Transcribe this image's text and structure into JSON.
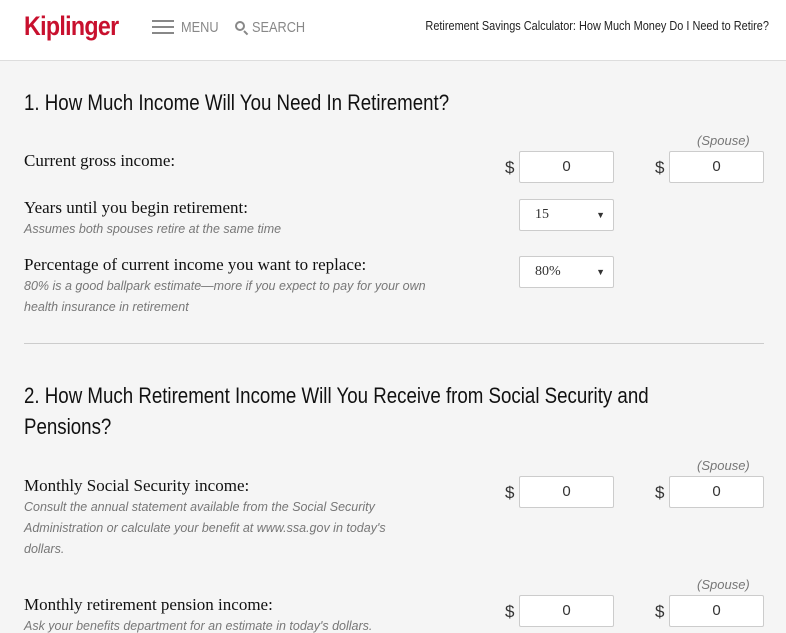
{
  "header": {
    "logo": "Kiplinger",
    "menu_label": "MENU",
    "search_label": "SEARCH",
    "page_heading": "Retirement Savings Calculator: How Much Money Do I Need to Retire?",
    "brand_color": "#c8102e"
  },
  "section1": {
    "title": "1. How Much Income Will You Need In Retirement?",
    "spouse_label": "(Spouse)",
    "gross_income": {
      "label": "Current gross income:",
      "currency": "$",
      "value": "0",
      "spouse_currency": "$",
      "spouse_value": "0"
    },
    "years": {
      "label": "Years until you begin retirement:",
      "hint": "Assumes both spouses retire at the same time",
      "selected": "15"
    },
    "percentage": {
      "label": "Percentage of current income you want to replace:",
      "hint_line1": "80% is a good ballpark estimate—more if you expect to pay for your own",
      "hint_line2": "health insurance in retirement",
      "selected": "80%"
    }
  },
  "section2": {
    "title_line1": "2. How Much Retirement Income Will You Receive from Social Security and",
    "title_line2": "Pensions?",
    "social_security": {
      "spouse_label": "(Spouse)",
      "label": "Monthly Social Security income:",
      "hint_line1": "Consult the annual statement available from the Social Security",
      "hint_line2": "Administration or calculate your benefit at www.ssa.gov in today's",
      "hint_line3": "dollars.",
      "currency": "$",
      "value": "0",
      "spouse_currency": "$",
      "spouse_value": "0"
    },
    "pension": {
      "spouse_label": "(Spouse)",
      "label": "Monthly retirement pension income:",
      "hint": "Ask your benefits department for an estimate in today's dollars.",
      "currency": "$",
      "value": "0",
      "spouse_currency": "$",
      "spouse_value": "0"
    }
  }
}
